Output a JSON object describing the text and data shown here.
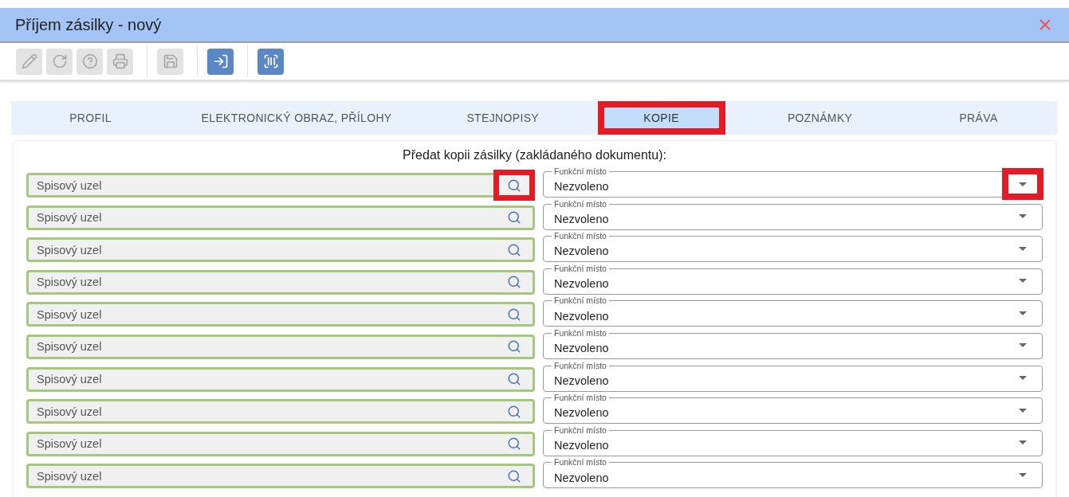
{
  "window": {
    "title": "Příjem zásilky - nový"
  },
  "toolbar": [
    {
      "kind": "edit",
      "disabled": true
    },
    {
      "kind": "refresh",
      "disabled": true
    },
    {
      "kind": "help",
      "disabled": true
    },
    {
      "kind": "print",
      "disabled": true
    },
    {
      "kind": "save",
      "disabled": true
    },
    {
      "kind": "enter",
      "disabled": false
    },
    {
      "kind": "barcode",
      "disabled": false
    }
  ],
  "tabs": [
    {
      "label": "PROFIL",
      "selected": false,
      "highlighted": false
    },
    {
      "label": "ELEKTRONICKÝ OBRAZ, PŘÍLOHY",
      "selected": false,
      "highlighted": false
    },
    {
      "label": "STEJNOPISY",
      "selected": false,
      "highlighted": false
    },
    {
      "label": "KOPIE",
      "selected": true,
      "highlighted": true
    },
    {
      "label": "POZNÁMKY",
      "selected": false,
      "highlighted": false
    },
    {
      "label": "PRÁVA",
      "selected": false,
      "highlighted": false
    }
  ],
  "panel": {
    "heading": "Předat kopii zásilky (zakládaného dokumentu):",
    "rows": [
      {
        "placeholder": "Spisový uzel",
        "select_label": "Funkční místo",
        "select_value": "Nezvoleno",
        "search_highlighted": true,
        "dropdown_highlighted": true
      },
      {
        "placeholder": "Spisový uzel",
        "select_label": "Funkční místo",
        "select_value": "Nezvoleno",
        "search_highlighted": false,
        "dropdown_highlighted": false
      },
      {
        "placeholder": "Spisový uzel",
        "select_label": "Funkční místo",
        "select_value": "Nezvoleno",
        "search_highlighted": false,
        "dropdown_highlighted": false
      },
      {
        "placeholder": "Spisový uzel",
        "select_label": "Funkční místo",
        "select_value": "Nezvoleno",
        "search_highlighted": false,
        "dropdown_highlighted": false
      },
      {
        "placeholder": "Spisový uzel",
        "select_label": "Funkční místo",
        "select_value": "Nezvoleno",
        "search_highlighted": false,
        "dropdown_highlighted": false
      },
      {
        "placeholder": "Spisový uzel",
        "select_label": "Funkční místo",
        "select_value": "Nezvoleno",
        "search_highlighted": false,
        "dropdown_highlighted": false
      },
      {
        "placeholder": "Spisový uzel",
        "select_label": "Funkční místo",
        "select_value": "Nezvoleno",
        "search_highlighted": false,
        "dropdown_highlighted": false
      },
      {
        "placeholder": "Spisový uzel",
        "select_label": "Funkční místo",
        "select_value": "Nezvoleno",
        "search_highlighted": false,
        "dropdown_highlighted": false
      },
      {
        "placeholder": "Spisový uzel",
        "select_label": "Funkční místo",
        "select_value": "Nezvoleno",
        "search_highlighted": false,
        "dropdown_highlighted": false
      },
      {
        "placeholder": "Spisový uzel",
        "select_label": "Funkční místo",
        "select_value": "Nezvoleno",
        "search_highlighted": false,
        "dropdown_highlighted": false
      }
    ]
  }
}
